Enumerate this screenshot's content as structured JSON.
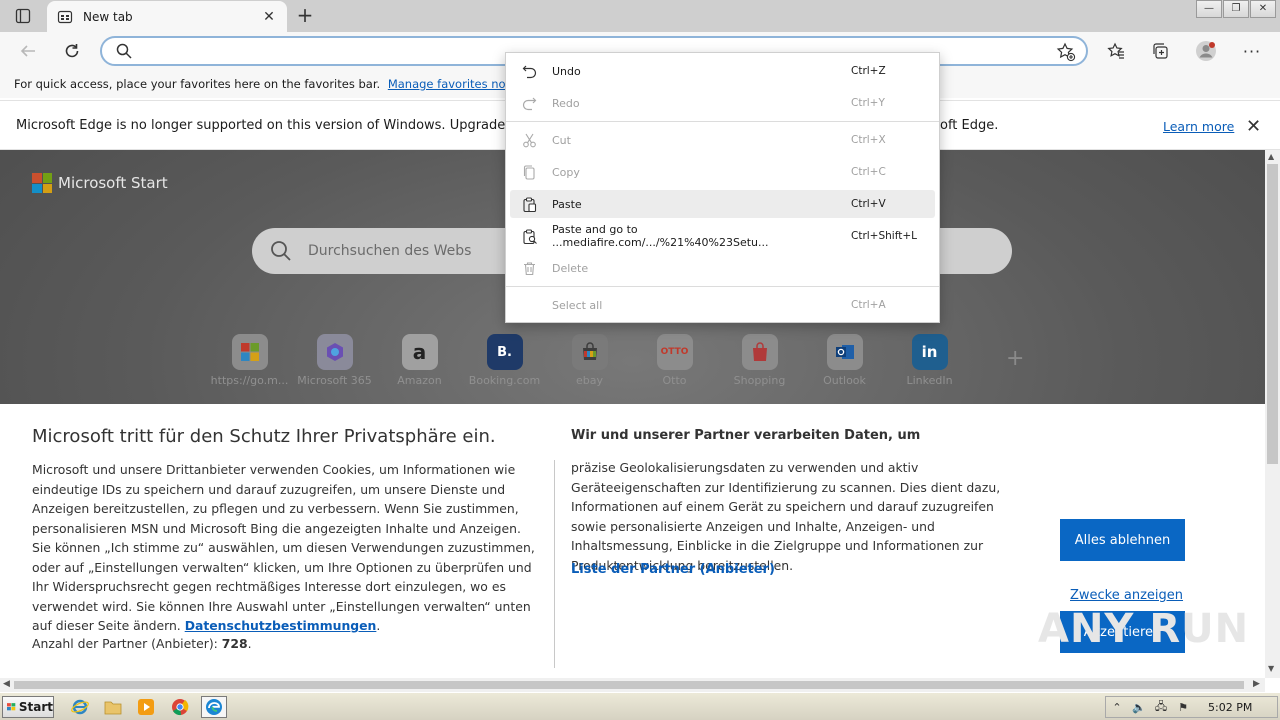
{
  "colors": {
    "accent": "#0a67c4",
    "link": "#0a5db8",
    "tabstrip": "#cfcfcf"
  },
  "tab": {
    "title": "New tab"
  },
  "favorites_bar": {
    "text": "For quick access, place your favorites here on the favorites bar.",
    "link": "Manage favorites now"
  },
  "infobar": {
    "message": "Microsoft Edge is no longer supported on this version of Windows. Upgrade to Wir",
    "message_tail": "oft Edge.",
    "learn_more": "Learn more"
  },
  "newtab_page": {
    "brand": "Microsoft Start",
    "search_placeholder": "Durchsuchen des Webs",
    "quick_links": [
      {
        "label": "https://go.m...",
        "icon": "windows-icon"
      },
      {
        "label": "Microsoft 365",
        "icon": "m365-icon"
      },
      {
        "label": "Amazon",
        "icon": "amazon-icon"
      },
      {
        "label": "Booking.com",
        "icon": "booking-icon"
      },
      {
        "label": "ebay",
        "icon": "ebay-icon"
      },
      {
        "label": "Otto",
        "icon": "otto-icon"
      },
      {
        "label": "Shopping",
        "icon": "shopping-icon"
      },
      {
        "label": "Outlook",
        "icon": "outlook-icon"
      },
      {
        "label": "LinkedIn",
        "icon": "linkedin-icon"
      }
    ]
  },
  "privacy": {
    "title": "Microsoft tritt für den Schutz Ihrer Privatsphäre ein.",
    "body": "Microsoft und unsere Drittanbieter verwenden Cookies, um Informationen wie eindeutige IDs zu speichern und darauf zuzugreifen, um unsere Dienste und Anzeigen bereitzustellen, zu pflegen und zu verbessern. Wenn Sie zustimmen, personalisieren MSN und Microsoft Bing die angezeigten Inhalte und Anzeigen. Sie können „Ich stimme zu“ auswählen, um diesen Verwendungen zuzustimmen, oder auf „Einstellungen verwalten“ klicken, um Ihre Optionen zu überprüfen und Ihr Widerspruchsrecht gegen rechtmäßiges Interesse dort einzulegen, wo es verwendet wird.  Sie können Ihre Auswahl unter „Einstellungen verwalten“ unten auf dieser Seite ändern. ",
    "privacy_link": "Datenschutzbestimmungen",
    "partners_label": "Anzahl der Partner (Anbieter): ",
    "partners_count": "728",
    "right_title": "Wir und unserer Partner verarbeiten Daten, um",
    "right_body": "präzise Geolokalisierungsdaten zu verwenden und aktiv Geräteeigenschaften zur Identifizierung zu scannen. Dies dient dazu, Informationen auf einem Gerät zu speichern und darauf zuzugreifen sowie personalisierte Anzeigen und Inhalte, Anzeigen- und Inhaltsmessung, Einblicke in die Zielgruppe und Informationen zur Produktentwicklung bereitzustellen.",
    "partners_link": "Liste der Partner (Anbieter)",
    "accept": "Akzeptieren",
    "reject": "Alles ablehnen",
    "purposes": "Zwecke anzeigen",
    "watermark": "ANY RUN"
  },
  "context_menu": [
    {
      "label": "Undo",
      "shortcut": "Ctrl+Z",
      "enabled": true,
      "icon": "undo-icon"
    },
    {
      "label": "Redo",
      "shortcut": "Ctrl+Y",
      "enabled": false,
      "icon": "redo-icon"
    },
    {
      "label": "Cut",
      "shortcut": "Ctrl+X",
      "enabled": false,
      "icon": "cut-icon"
    },
    {
      "label": "Copy",
      "shortcut": "Ctrl+C",
      "enabled": false,
      "icon": "copy-icon"
    },
    {
      "label": "Paste",
      "shortcut": "Ctrl+V",
      "enabled": true,
      "icon": "paste-icon"
    },
    {
      "label": "Paste and go to ...mediafire.com/.../%21%40%23Setu...",
      "shortcut": "Ctrl+Shift+L",
      "enabled": true,
      "icon": "paste-go-icon"
    },
    {
      "label": "Delete",
      "shortcut": "",
      "enabled": false,
      "icon": "delete-icon"
    },
    {
      "label": "Select all",
      "shortcut": "Ctrl+A",
      "enabled": false,
      "icon": ""
    }
  ],
  "taskbar": {
    "start": "Start",
    "clock": "5:02 PM"
  }
}
